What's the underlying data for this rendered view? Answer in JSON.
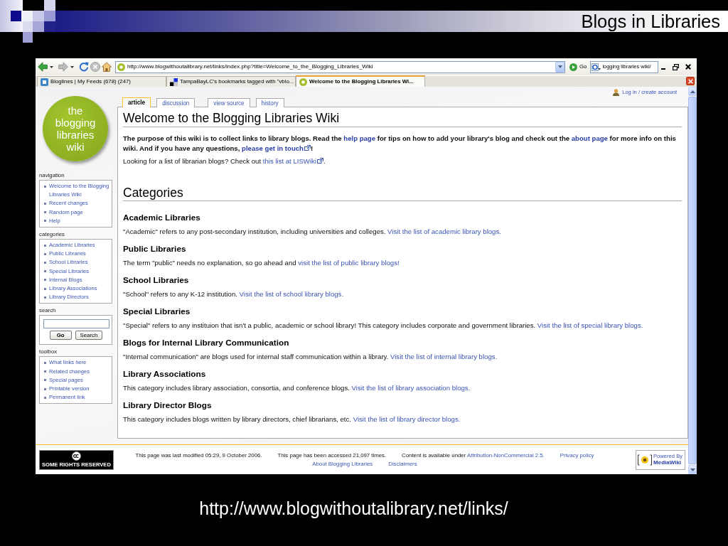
{
  "slide": {
    "title": "Blogs in Libraries",
    "caption": "http://www.blogwithoutalibrary.net/links/"
  },
  "browser": {
    "address": "http://www.blogwithoutalibrary.net/links/index.php?title=Welcome_to_the_Blogging_Libraries_Wiki",
    "go_label": "Go",
    "search_value": "logging libraries wiki/",
    "tabs": [
      {
        "label": "Bloglines | My Feeds (678) (247)",
        "kind": "tile",
        "selected": false
      },
      {
        "label": "TampaBayLC's bookmarks tagged with \"vblo...",
        "kind": "squares",
        "selected": false
      },
      {
        "label": "Welcome to the Blogging Libraries Wi...",
        "kind": "circle",
        "selected": true
      }
    ]
  },
  "wiki": {
    "logo": "the blogging libraries wiki",
    "user_link": "Log in / create account",
    "page_tabs": [
      {
        "label": "article",
        "selected": true
      },
      {
        "label": "discussion",
        "selected": false
      },
      {
        "label": "view source",
        "selected": false
      },
      {
        "label": "history",
        "selected": false
      }
    ],
    "portlets": [
      {
        "title": "navigation",
        "kind": "links",
        "items": [
          "Welcome to the Blogging Libraries Wiki",
          "Recent changes",
          "Random page",
          "Help"
        ]
      },
      {
        "title": "categories",
        "kind": "links",
        "items": [
          "Academic Libraries",
          "Public Libraries",
          "School Libraries",
          "Special Libraries",
          "Internal Blogs",
          "Library Associations",
          "Library Directors"
        ]
      },
      {
        "title": "search",
        "kind": "search",
        "buttons": [
          "Go",
          "Search"
        ]
      },
      {
        "title": "toolbox",
        "kind": "links",
        "items": [
          "What links here",
          "Related changes",
          "Special pages",
          "Printable version",
          "Permanent link"
        ]
      }
    ],
    "title": "Welcome to the Blogging Libraries Wiki",
    "intro": [
      {
        "bold": true,
        "parts": [
          {
            "kind": "text",
            "text": "The purpose of this wiki is to collect links to library blogs. Read the "
          },
          {
            "kind": "link",
            "text": "help page"
          },
          {
            "kind": "text",
            "text": " for tips on how to add your library's blog and check out the "
          },
          {
            "kind": "link",
            "text": "about page"
          },
          {
            "kind": "text",
            "text": " for more info on this wiki. And if you have any questions, "
          },
          {
            "kind": "external",
            "text": "please get in touch"
          },
          {
            "kind": "text",
            "text": "!"
          }
        ]
      },
      {
        "bold": false,
        "parts": [
          {
            "kind": "text",
            "text": "Looking for a list of librarian blogs? Check out "
          },
          {
            "kind": "external",
            "text": "this list at LISWiki"
          },
          {
            "kind": "text",
            "text": "."
          }
        ]
      }
    ],
    "section_title": "Categories",
    "categories": [
      {
        "heading": "Academic Libraries",
        "parts": [
          {
            "kind": "text",
            "text": "\"Academic\" refers to any post-secondary institution, including universities and colleges. "
          },
          {
            "kind": "link",
            "text": "Visit the list of academic library blogs."
          }
        ]
      },
      {
        "heading": "Public Libraries",
        "parts": [
          {
            "kind": "text",
            "text": "The term \"public\" needs no explanation, so go ahead and "
          },
          {
            "kind": "link",
            "text": "visit the list of public library blogs!"
          }
        ]
      },
      {
        "heading": "School Libraries",
        "parts": [
          {
            "kind": "text",
            "text": "\"School\" refers to any K-12 institution. "
          },
          {
            "kind": "link",
            "text": "Visit the list of school library blogs."
          }
        ]
      },
      {
        "heading": "Special Libraries",
        "parts": [
          {
            "kind": "text",
            "text": "\"Special\" refers to any instituion that isn't a public, academic or school library! This category includes corporate and government libraries. "
          },
          {
            "kind": "link",
            "text": "Visit the list of special library blogs."
          }
        ]
      },
      {
        "heading": "Blogs for Internal Library Communication",
        "parts": [
          {
            "kind": "text",
            "text": "\"Internal communication\" are blogs used for internal staff communication within a library. "
          },
          {
            "kind": "link",
            "text": "Visit the list of internal library blogs."
          }
        ]
      },
      {
        "heading": "Library Associations",
        "parts": [
          {
            "kind": "text",
            "text": "This category includes library association, consortia, and conference blogs. "
          },
          {
            "kind": "link",
            "text": "Visit the list of library association blogs."
          }
        ]
      },
      {
        "heading": "Library Director Blogs",
        "parts": [
          {
            "kind": "text",
            "text": "This category includes blogs written by library directors, chief librarians, etc. "
          },
          {
            "kind": "link",
            "text": "Visit the list of library director blogs."
          }
        ]
      }
    ],
    "footer": {
      "license_badge": "SOME RIGHTS RESERVED",
      "items": [
        {
          "parts": [
            {
              "kind": "text",
              "text": "This page was last modified 05:29, 9 October 2006."
            }
          ]
        },
        {
          "parts": [
            {
              "kind": "text",
              "text": "This page has been accessed 21,097 times."
            }
          ]
        },
        {
          "parts": [
            {
              "kind": "text",
              "text": "Content is available under "
            },
            {
              "kind": "link",
              "text": "Attribution-NonCommercial 2.5."
            }
          ]
        },
        {
          "parts": [
            {
              "kind": "link",
              "text": "Privacy policy"
            }
          ]
        },
        {
          "parts": [
            {
              "kind": "link",
              "text": "About Blogging Libraries"
            }
          ]
        },
        {
          "parts": [
            {
              "kind": "link",
              "text": "Disclaimers"
            }
          ]
        }
      ],
      "powered_badge": [
        "Powered By",
        "MediaWiki"
      ]
    }
  }
}
